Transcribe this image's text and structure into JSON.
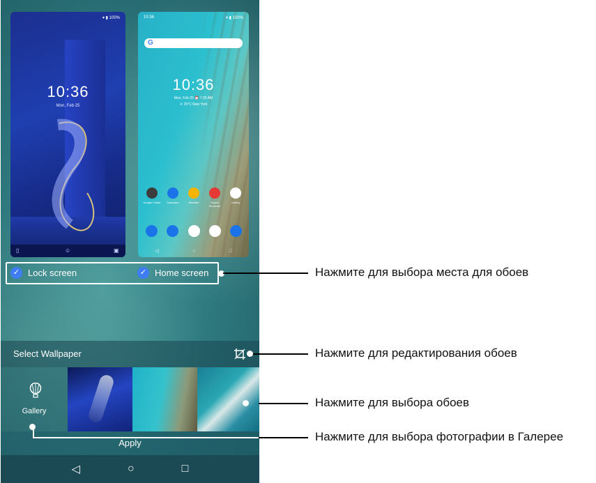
{
  "lock_preview": {
    "status": "▾ ▮ 100%",
    "time": "10:36",
    "date": "Mon, Feb 25",
    "bottom_icons": [
      "▯",
      "☺",
      "▣"
    ]
  },
  "home_preview": {
    "status_time": "10:36",
    "status_right": "▾ ▮ 100%",
    "search_glyph": "G",
    "time": "10:36",
    "date": "Mon, Feb 25   ⏰ 7:30 AM",
    "weather": "☀ 25°C   New York",
    "apps": [
      {
        "label": "Google Folder",
        "color": "#3d3d3d"
      },
      {
        "label": "Calculator",
        "color": "#1a73e8"
      },
      {
        "label": "Weather",
        "color": "#f5b400"
      },
      {
        "label": "Sound Recorder",
        "color": "#e53935"
      },
      {
        "label": "Gallery",
        "color": "#ffffff"
      }
    ],
    "dock_colors": [
      "#1a73e8",
      "#1a73e8",
      "#ffffff",
      "#ffffff",
      "#1a73e8"
    ],
    "nav": [
      "◁",
      "○",
      "□"
    ]
  },
  "targets": {
    "lock_label": "Lock screen",
    "home_label": "Home screen",
    "check": "✓"
  },
  "select_bar": {
    "label": "Select Wallpaper"
  },
  "gallery": {
    "label": "Gallery"
  },
  "apply_label": "Apply",
  "system_nav": [
    "◁",
    "○",
    "□"
  ],
  "callouts": {
    "place": "Нажмите для выбора места для обоев",
    "edit": "Нажмите для редактирования обоев",
    "choose": "Нажмите для выбора обоев",
    "gallery": "Нажмите для выбора фотографии в Галерее"
  }
}
